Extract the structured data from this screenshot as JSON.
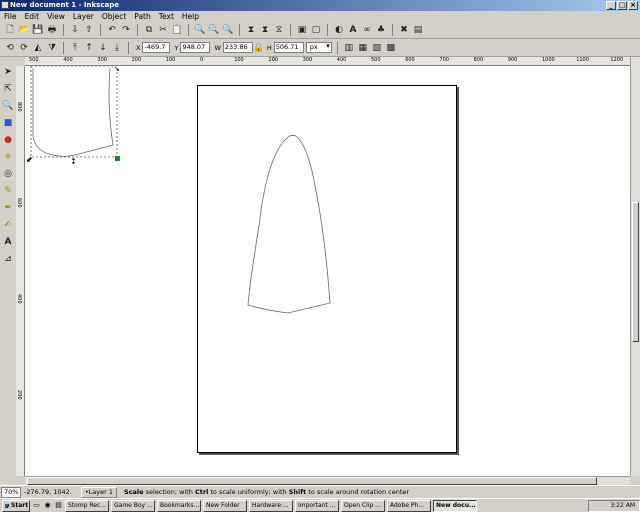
{
  "window": {
    "title": "New document 1 - Inkscape"
  },
  "menu": [
    "File",
    "Edit",
    "View",
    "Layer",
    "Object",
    "Path",
    "Text",
    "Help"
  ],
  "selection_toolbar": {
    "x_label": "X",
    "x_value": "-469.7",
    "y_label": "Y",
    "y_value": "948.07",
    "w_label": "W",
    "w_value": "233.86",
    "h_label": "H",
    "h_value": "506.71",
    "unit": "px"
  },
  "hruler_labels": [
    "500",
    "400",
    "300",
    "200",
    "100",
    "0",
    "100",
    "200",
    "300",
    "400",
    "500",
    "600",
    "700",
    "800",
    "900",
    "1000",
    "1100",
    "1200"
  ],
  "vruler_labels": [
    "800",
    "600",
    "400",
    "200"
  ],
  "status": {
    "zoom": "70%",
    "coords": "-276.79, 1042.",
    "layer": "•Layer 1",
    "msg_b1": "Scale",
    "msg_t1": " selection; with ",
    "msg_b2": "Ctrl",
    "msg_t2": " to scale uniformly; with ",
    "msg_b3": "Shift",
    "msg_t3": " to scale around rotation center"
  },
  "taskbar": {
    "start": "Start",
    "tasks": [
      "Stomp Rec...",
      "Game Boy ...",
      "Bookmarks...",
      "New Folder",
      "Hardware:...",
      "Important ...",
      "Open Clip ...",
      "Adobe Ph...",
      "New docu..."
    ],
    "clock": "3:22 AM"
  }
}
